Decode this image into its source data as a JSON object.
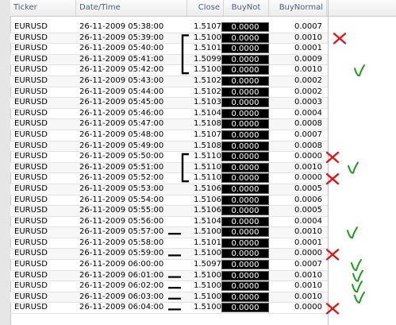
{
  "columns": {
    "ticker": "Ticker",
    "datetime": "Date/Time",
    "close": "Close",
    "buy_not": "BuyNot",
    "buy_normal": "BuyNormal"
  },
  "rows": [
    {
      "ticker": "EURUSD",
      "datetime": "26-11-2009 05:38:00",
      "close": "1.5107",
      "buy_not": "0.0000",
      "buy_normal": "0.0007"
    },
    {
      "ticker": "EURUSD",
      "datetime": "26-11-2009 05:39:00",
      "close": "1.5100",
      "buy_not": "0.0000",
      "buy_normal": "0.0010"
    },
    {
      "ticker": "EURUSD",
      "datetime": "26-11-2009 05:40:00",
      "close": "1.5101",
      "buy_not": "0.0000",
      "buy_normal": "0.0001"
    },
    {
      "ticker": "EURUSD",
      "datetime": "26-11-2009 05:41:00",
      "close": "1.5099",
      "buy_not": "0.0000",
      "buy_normal": "0.0009"
    },
    {
      "ticker": "EURUSD",
      "datetime": "26-11-2009 05:42:00",
      "close": "1.5100",
      "buy_not": "0.0000",
      "buy_normal": "0.0010"
    },
    {
      "ticker": "EURUSD",
      "datetime": "26-11-2009 05:43:00",
      "close": "1.5102",
      "buy_not": "0.0000",
      "buy_normal": "0.0002"
    },
    {
      "ticker": "EURUSD",
      "datetime": "26-11-2009 05:44:00",
      "close": "1.5102",
      "buy_not": "0.0000",
      "buy_normal": "0.0002"
    },
    {
      "ticker": "EURUSD",
      "datetime": "26-11-2009 05:45:00",
      "close": "1.5103",
      "buy_not": "0.0000",
      "buy_normal": "0.0003"
    },
    {
      "ticker": "EURUSD",
      "datetime": "26-11-2009 05:46:00",
      "close": "1.5104",
      "buy_not": "0.0000",
      "buy_normal": "0.0004"
    },
    {
      "ticker": "EURUSD",
      "datetime": "26-11-2009 05:47:00",
      "close": "1.5108",
      "buy_not": "0.0000",
      "buy_normal": "0.0008"
    },
    {
      "ticker": "EURUSD",
      "datetime": "26-11-2009 05:48:00",
      "close": "1.5107",
      "buy_not": "0.0000",
      "buy_normal": "0.0007"
    },
    {
      "ticker": "EURUSD",
      "datetime": "26-11-2009 05:49:00",
      "close": "1.5108",
      "buy_not": "0.0000",
      "buy_normal": "0.0008"
    },
    {
      "ticker": "EURUSD",
      "datetime": "26-11-2009 05:50:00",
      "close": "1.5110",
      "buy_not": "0.0000",
      "buy_normal": "0.0000"
    },
    {
      "ticker": "EURUSD",
      "datetime": "26-11-2009 05:51:00",
      "close": "1.5110",
      "buy_not": "0.0000",
      "buy_normal": "0.0010"
    },
    {
      "ticker": "EURUSD",
      "datetime": "26-11-2009 05:52:00",
      "close": "1.5110",
      "buy_not": "0.0000",
      "buy_normal": "0.0000"
    },
    {
      "ticker": "EURUSD",
      "datetime": "26-11-2009 05:53:00",
      "close": "1.5106",
      "buy_not": "0.0000",
      "buy_normal": "0.0005"
    },
    {
      "ticker": "EURUSD",
      "datetime": "26-11-2009 05:54:00",
      "close": "1.5106",
      "buy_not": "0.0000",
      "buy_normal": "0.0006"
    },
    {
      "ticker": "EURUSD",
      "datetime": "26-11-2009 05:55:00",
      "close": "1.5106",
      "buy_not": "0.0000",
      "buy_normal": "0.0005"
    },
    {
      "ticker": "EURUSD",
      "datetime": "26-11-2009 05:56:00",
      "close": "1.5104",
      "buy_not": "0.0000",
      "buy_normal": "0.0004"
    },
    {
      "ticker": "EURUSD",
      "datetime": "26-11-2009 05:57:00",
      "close": "1.5100",
      "buy_not": "0.0000",
      "buy_normal": "0.0010"
    },
    {
      "ticker": "EURUSD",
      "datetime": "26-11-2009 05:58:00",
      "close": "1.5101",
      "buy_not": "0.0000",
      "buy_normal": "0.0001"
    },
    {
      "ticker": "EURUSD",
      "datetime": "26-11-2009 05:59:00",
      "close": "1.5100",
      "buy_not": "0.0000",
      "buy_normal": "0.0000"
    },
    {
      "ticker": "EURUSD",
      "datetime": "26-11-2009 06:00:00",
      "close": "1.5097",
      "buy_not": "0.0000",
      "buy_normal": "0.0007"
    },
    {
      "ticker": "EURUSD",
      "datetime": "26-11-2009 06:01:00",
      "close": "1.5100",
      "buy_not": "0.0000",
      "buy_normal": "0.0010"
    },
    {
      "ticker": "EURUSD",
      "datetime": "26-11-2009 06:02:00",
      "close": "1.5100",
      "buy_not": "0.0000",
      "buy_normal": "0.0010"
    },
    {
      "ticker": "EURUSD",
      "datetime": "26-11-2009 06:03:00",
      "close": "1.5100",
      "buy_not": "0.0000",
      "buy_normal": "0.0010"
    },
    {
      "ticker": "EURUSD",
      "datetime": "26-11-2009 06:04:00",
      "close": "1.5100",
      "buy_not": "0.0000",
      "buy_normal": "0.0000"
    }
  ],
  "colors": {
    "cross": "#e01515",
    "check": "#1e9a1e",
    "bracket": "#000000",
    "buy_not_bg": "#000000",
    "buy_not_text": "#ffffff"
  },
  "annotations": {
    "crosses_at_rows": [
      1,
      12,
      14,
      21,
      26
    ],
    "checks_at_rows": [
      4,
      13,
      19,
      22,
      23,
      24,
      25
    ],
    "brackets": [
      [
        1,
        4
      ],
      [
        12,
        14
      ]
    ],
    "dashes_at_rows": [
      19,
      21,
      23,
      24,
      25,
      26
    ]
  }
}
